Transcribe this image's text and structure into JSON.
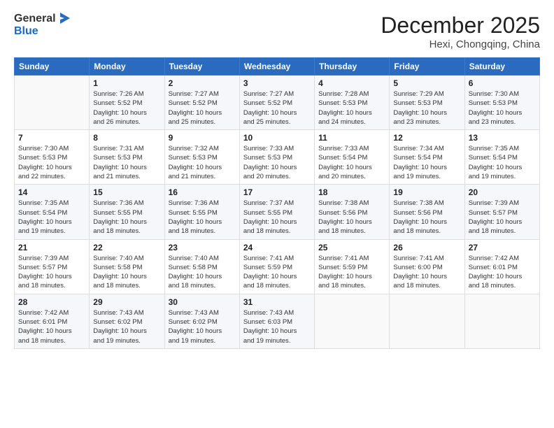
{
  "header": {
    "logo_general": "General",
    "logo_blue": "Blue",
    "month_title": "December 2025",
    "subtitle": "Hexi, Chongqing, China"
  },
  "weekdays": [
    "Sunday",
    "Monday",
    "Tuesday",
    "Wednesday",
    "Thursday",
    "Friday",
    "Saturday"
  ],
  "weeks": [
    [
      {
        "day": "",
        "info": ""
      },
      {
        "day": "1",
        "info": "Sunrise: 7:26 AM\nSunset: 5:52 PM\nDaylight: 10 hours\nand 26 minutes."
      },
      {
        "day": "2",
        "info": "Sunrise: 7:27 AM\nSunset: 5:52 PM\nDaylight: 10 hours\nand 25 minutes."
      },
      {
        "day": "3",
        "info": "Sunrise: 7:27 AM\nSunset: 5:52 PM\nDaylight: 10 hours\nand 25 minutes."
      },
      {
        "day": "4",
        "info": "Sunrise: 7:28 AM\nSunset: 5:53 PM\nDaylight: 10 hours\nand 24 minutes."
      },
      {
        "day": "5",
        "info": "Sunrise: 7:29 AM\nSunset: 5:53 PM\nDaylight: 10 hours\nand 23 minutes."
      },
      {
        "day": "6",
        "info": "Sunrise: 7:30 AM\nSunset: 5:53 PM\nDaylight: 10 hours\nand 23 minutes."
      }
    ],
    [
      {
        "day": "7",
        "info": "Sunrise: 7:30 AM\nSunset: 5:53 PM\nDaylight: 10 hours\nand 22 minutes."
      },
      {
        "day": "8",
        "info": "Sunrise: 7:31 AM\nSunset: 5:53 PM\nDaylight: 10 hours\nand 21 minutes."
      },
      {
        "day": "9",
        "info": "Sunrise: 7:32 AM\nSunset: 5:53 PM\nDaylight: 10 hours\nand 21 minutes."
      },
      {
        "day": "10",
        "info": "Sunrise: 7:33 AM\nSunset: 5:53 PM\nDaylight: 10 hours\nand 20 minutes."
      },
      {
        "day": "11",
        "info": "Sunrise: 7:33 AM\nSunset: 5:54 PM\nDaylight: 10 hours\nand 20 minutes."
      },
      {
        "day": "12",
        "info": "Sunrise: 7:34 AM\nSunset: 5:54 PM\nDaylight: 10 hours\nand 19 minutes."
      },
      {
        "day": "13",
        "info": "Sunrise: 7:35 AM\nSunset: 5:54 PM\nDaylight: 10 hours\nand 19 minutes."
      }
    ],
    [
      {
        "day": "14",
        "info": "Sunrise: 7:35 AM\nSunset: 5:54 PM\nDaylight: 10 hours\nand 19 minutes."
      },
      {
        "day": "15",
        "info": "Sunrise: 7:36 AM\nSunset: 5:55 PM\nDaylight: 10 hours\nand 18 minutes."
      },
      {
        "day": "16",
        "info": "Sunrise: 7:36 AM\nSunset: 5:55 PM\nDaylight: 10 hours\nand 18 minutes."
      },
      {
        "day": "17",
        "info": "Sunrise: 7:37 AM\nSunset: 5:55 PM\nDaylight: 10 hours\nand 18 minutes."
      },
      {
        "day": "18",
        "info": "Sunrise: 7:38 AM\nSunset: 5:56 PM\nDaylight: 10 hours\nand 18 minutes."
      },
      {
        "day": "19",
        "info": "Sunrise: 7:38 AM\nSunset: 5:56 PM\nDaylight: 10 hours\nand 18 minutes."
      },
      {
        "day": "20",
        "info": "Sunrise: 7:39 AM\nSunset: 5:57 PM\nDaylight: 10 hours\nand 18 minutes."
      }
    ],
    [
      {
        "day": "21",
        "info": "Sunrise: 7:39 AM\nSunset: 5:57 PM\nDaylight: 10 hours\nand 18 minutes."
      },
      {
        "day": "22",
        "info": "Sunrise: 7:40 AM\nSunset: 5:58 PM\nDaylight: 10 hours\nand 18 minutes."
      },
      {
        "day": "23",
        "info": "Sunrise: 7:40 AM\nSunset: 5:58 PM\nDaylight: 10 hours\nand 18 minutes."
      },
      {
        "day": "24",
        "info": "Sunrise: 7:41 AM\nSunset: 5:59 PM\nDaylight: 10 hours\nand 18 minutes."
      },
      {
        "day": "25",
        "info": "Sunrise: 7:41 AM\nSunset: 5:59 PM\nDaylight: 10 hours\nand 18 minutes."
      },
      {
        "day": "26",
        "info": "Sunrise: 7:41 AM\nSunset: 6:00 PM\nDaylight: 10 hours\nand 18 minutes."
      },
      {
        "day": "27",
        "info": "Sunrise: 7:42 AM\nSunset: 6:01 PM\nDaylight: 10 hours\nand 18 minutes."
      }
    ],
    [
      {
        "day": "28",
        "info": "Sunrise: 7:42 AM\nSunset: 6:01 PM\nDaylight: 10 hours\nand 18 minutes."
      },
      {
        "day": "29",
        "info": "Sunrise: 7:43 AM\nSunset: 6:02 PM\nDaylight: 10 hours\nand 19 minutes."
      },
      {
        "day": "30",
        "info": "Sunrise: 7:43 AM\nSunset: 6:02 PM\nDaylight: 10 hours\nand 19 minutes."
      },
      {
        "day": "31",
        "info": "Sunrise: 7:43 AM\nSunset: 6:03 PM\nDaylight: 10 hours\nand 19 minutes."
      },
      {
        "day": "",
        "info": ""
      },
      {
        "day": "",
        "info": ""
      },
      {
        "day": "",
        "info": ""
      }
    ]
  ]
}
